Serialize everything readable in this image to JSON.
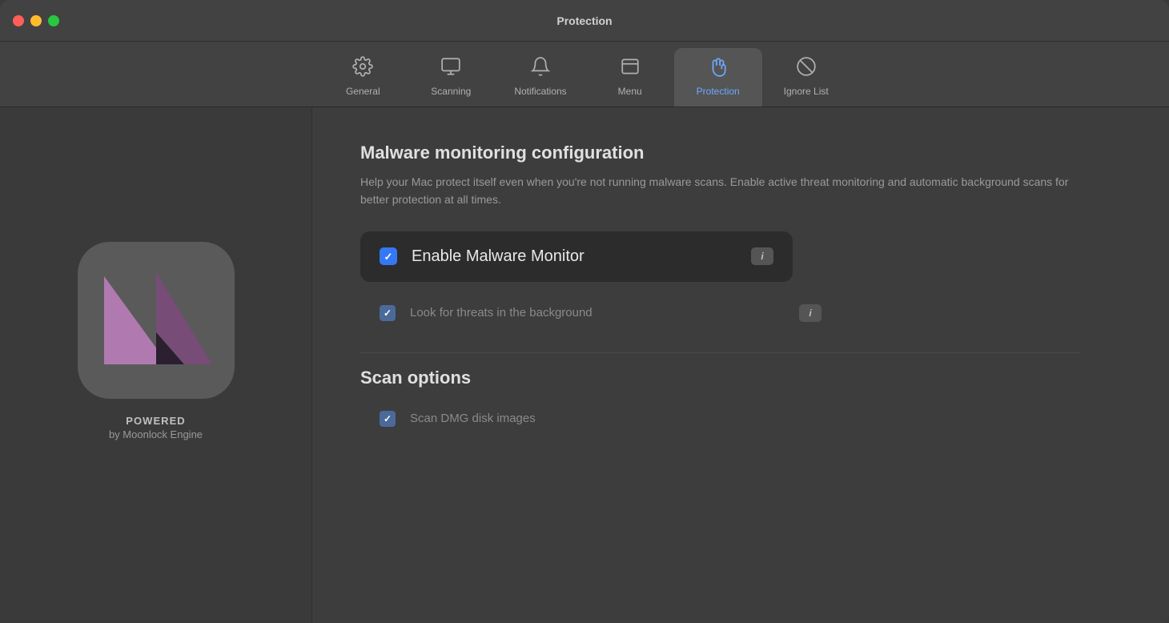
{
  "window": {
    "title": "Protection"
  },
  "tabs": [
    {
      "id": "general",
      "label": "General",
      "icon": "⚙",
      "active": false
    },
    {
      "id": "scanning",
      "label": "Scanning",
      "icon": "🖥",
      "active": false
    },
    {
      "id": "notifications",
      "label": "Notifications",
      "icon": "🔔",
      "active": false
    },
    {
      "id": "menu",
      "label": "Menu",
      "icon": "▭",
      "active": false
    },
    {
      "id": "protection",
      "label": "Protection",
      "icon": "✋",
      "active": true
    },
    {
      "id": "ignore-list",
      "label": "Ignore List",
      "icon": "🚫",
      "active": false
    }
  ],
  "sidebar": {
    "powered_main": "POWERED",
    "powered_sub": "by Moonlock Engine"
  },
  "main": {
    "section_title": "Malware monitoring configuration",
    "section_description": "Help your Mac protect itself even when you're not running malware scans. Enable active threat monitoring and automatic background scans for better protection at all times.",
    "options": [
      {
        "id": "enable-malware-monitor",
        "label": "Enable Malware Monitor",
        "checked": true,
        "highlighted": true
      },
      {
        "id": "look-for-threats",
        "label": "Look for threats in the background",
        "checked": true,
        "highlighted": false
      }
    ],
    "scan_options_title": "Scan options",
    "scan_options": [
      {
        "id": "scan-dmg",
        "label": "Scan DMG disk images",
        "checked": true
      }
    ],
    "info_badge_label": "i"
  }
}
